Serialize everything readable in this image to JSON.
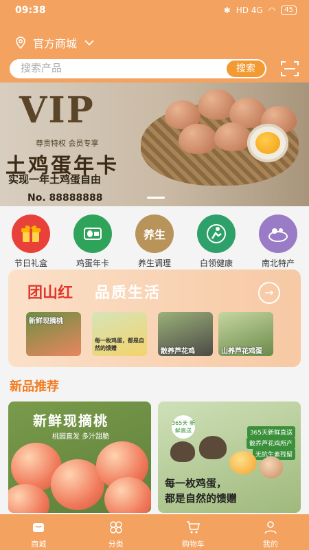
{
  "status_bar": {
    "time": "09:38",
    "battery": "45",
    "signal_labels": "HD 4G"
  },
  "header": {
    "store_name": "官方商城"
  },
  "search": {
    "placeholder": "搜索产品",
    "button_label": "搜索"
  },
  "banner": {
    "headline": "VIP",
    "subtitle": "尊贵特权 会员专享",
    "title": "土鸡蛋年卡",
    "description": "实现一年土鸡蛋自由",
    "number": "No. 88888888"
  },
  "categories": [
    {
      "label": "节日礼盒",
      "icon": "gift-box-icon",
      "color": "#e8413a",
      "glyph": "🎁"
    },
    {
      "label": "鸡蛋年卡",
      "icon": "egg-card-icon",
      "color": "#2fa35a",
      "glyph": "🥚"
    },
    {
      "label": "养生调理",
      "icon": "health-care-icon",
      "color": "#b8935a",
      "glyph": "养生"
    },
    {
      "label": "白领健康",
      "icon": "fitness-icon",
      "color": "#2ea16a",
      "glyph": "🏃"
    },
    {
      "label": "南北特产",
      "icon": "specialty-icon",
      "color": "#9a7bc6",
      "glyph": "🥗"
    }
  ],
  "promo": {
    "title": "团山红",
    "subtitle": "品质生活",
    "thumbs": [
      {
        "text": "新鲜现摘桃"
      },
      {
        "text": "每一枚鸡蛋，都是自然的馈赠"
      },
      {
        "text": "散养芦花鸡"
      },
      {
        "text": "山养芦花鸡蛋"
      }
    ]
  },
  "section": {
    "title": "新品推荐"
  },
  "cards": [
    {
      "title": "新鲜现摘桃",
      "subtitle": "桃园直发 多汁甜脆"
    },
    {
      "badge": "365天 新鲜直送",
      "tags": [
        "365天新鲜直送",
        "散养芦花鸡所产",
        "无抗生素残留"
      ],
      "line1": "每一枚鸡蛋，",
      "line2": "都是自然的馈赠"
    }
  ],
  "tabbar": {
    "items": [
      {
        "label": "商城",
        "icon": "mall-icon"
      },
      {
        "label": "分类",
        "icon": "category-icon"
      },
      {
        "label": "购物车",
        "icon": "cart-icon"
      },
      {
        "label": "我的",
        "icon": "profile-icon"
      }
    ]
  },
  "colors": {
    "accent": "#f3a25f",
    "button": "#f39a33",
    "section_title": "#f47a1f",
    "promo_title": "#e0352b"
  }
}
